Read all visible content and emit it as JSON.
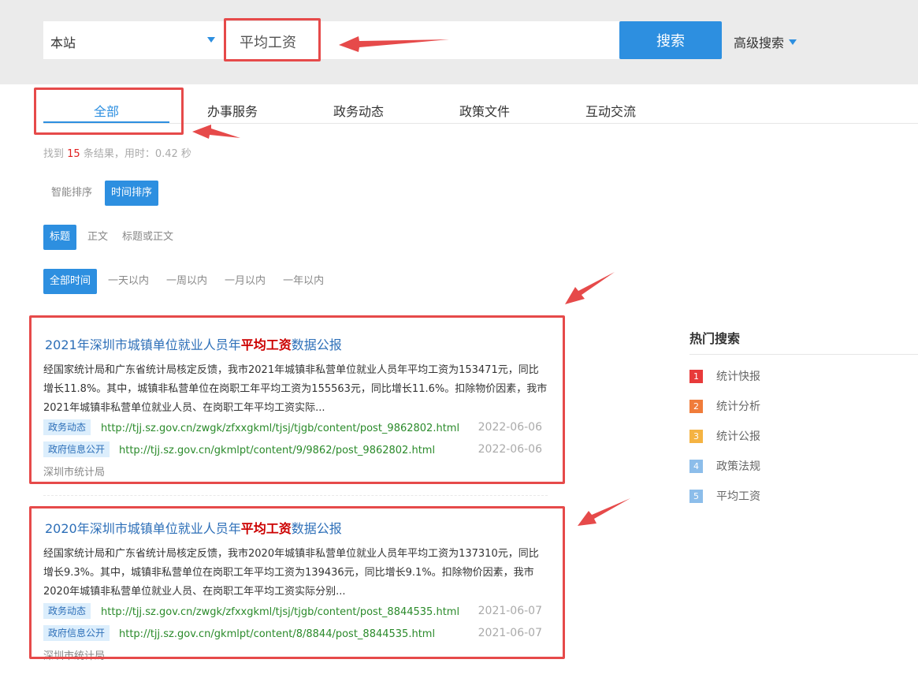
{
  "search": {
    "scope": "本站",
    "query": "平均工资",
    "button_label": "搜索",
    "advanced_label": "高级搜索"
  },
  "tabs": [
    {
      "label": "全部"
    },
    {
      "label": "办事服务"
    },
    {
      "label": "政务动态"
    },
    {
      "label": "政策文件"
    },
    {
      "label": "互动交流"
    }
  ],
  "result_count": {
    "prefix": "找到",
    "count": "15",
    "suffix": "条结果，用时：0.42 秒"
  },
  "sort_options": [
    "智能排序",
    "时间排序"
  ],
  "scope_options": [
    "标题",
    "正文",
    "标题或正文"
  ],
  "time_options": [
    "全部时间",
    "一天以内",
    "一周以内",
    "一月以内",
    "一年以内"
  ],
  "results": [
    {
      "title_pre": "2021年深圳市城镇单位就业人员年",
      "title_hl": "平均工资",
      "title_post": "数据公报",
      "snippet": "经国家统计局和广东省统计局核定反馈，我市2021年城镇非私营单位就业人员年平均工资为153471元，同比增长11.8%。其中，城镇非私营单位在岗职工年平均工资为155563元，同比增长11.6%。扣除物价因素，我市2021年城镇非私营单位就业人员、在岗职工年平均工资实际...",
      "tag1": "政务动态",
      "url1": "http://tjj.sz.gov.cn/zwgk/zfxxgkml/tjsj/tjgb/content/post_9862802.html",
      "date1": "2022-06-06",
      "tag2": "政府信息公开",
      "url2": "http://tjj.sz.gov.cn/gkmlpt/content/9/9862/post_9862802.html",
      "date2": "2022-06-06",
      "source": "深圳市统计局"
    },
    {
      "title_pre": "2020年深圳市城镇单位就业人员年",
      "title_hl": "平均工资",
      "title_post": "数据公报",
      "snippet": "经国家统计局和广东省统计局核定反馈，我市2020年城镇非私营单位就业人员年平均工资为137310元，同比增长9.3%。其中，城镇非私营单位在岗职工年平均工资为139436元，同比增长9.1%。扣除物价因素，我市2020年城镇非私营单位就业人员、在岗职工年平均工资实际分别...",
      "tag1": "政务动态",
      "url1": "http://tjj.sz.gov.cn/zwgk/zfxxgkml/tjsj/tjgb/content/post_8844535.html",
      "date1": "2021-06-07",
      "tag2": "政府信息公开",
      "url2": "http://tjj.sz.gov.cn/gkmlpt/content/8/8844/post_8844535.html",
      "date2": "2021-06-07",
      "source": "深圳市统计局"
    }
  ],
  "hot": {
    "title": "热门搜索",
    "items": [
      {
        "rank": "1",
        "label": "统计快报",
        "color": "#e83a3a"
      },
      {
        "rank": "2",
        "label": "统计分析",
        "color": "#f07c3a"
      },
      {
        "rank": "3",
        "label": "统计公报",
        "color": "#f5b342"
      },
      {
        "rank": "4",
        "label": "政策法规",
        "color": "#8cbdea"
      },
      {
        "rank": "5",
        "label": "平均工资",
        "color": "#8cbdea"
      }
    ]
  },
  "colors": {
    "accent": "#2d8fe0",
    "annotation": "#e64a4a"
  }
}
